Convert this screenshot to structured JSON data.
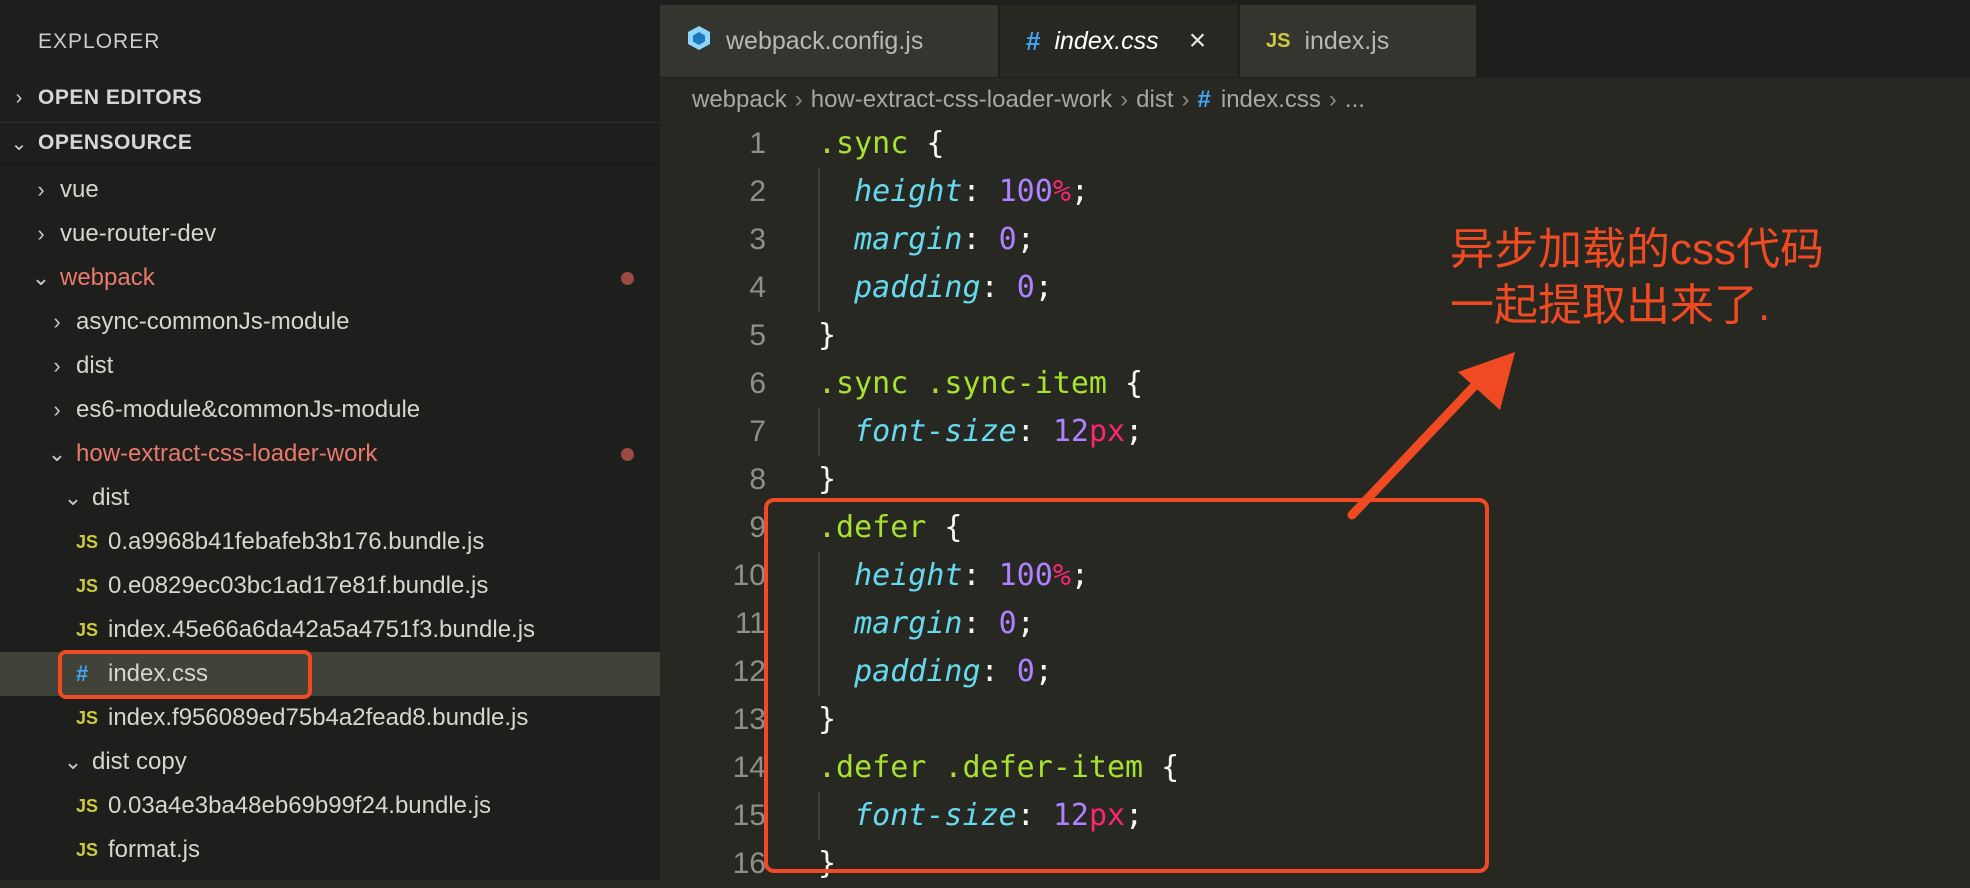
{
  "sidebar": {
    "title": "EXPLORER",
    "sections": [
      {
        "label": "OPEN EDITORS",
        "expanded": false
      },
      {
        "label": "OPENSOURCE",
        "expanded": true
      }
    ],
    "tree": [
      {
        "name": "vue",
        "kind": "folder",
        "expanded": false,
        "depth": 1
      },
      {
        "name": "vue-router-dev",
        "kind": "folder",
        "expanded": false,
        "depth": 1
      },
      {
        "name": "webpack",
        "kind": "folder",
        "expanded": true,
        "depth": 1,
        "modified": true
      },
      {
        "name": "async-commonJs-module",
        "kind": "folder",
        "expanded": false,
        "depth": 2
      },
      {
        "name": "dist",
        "kind": "folder",
        "expanded": false,
        "depth": 2
      },
      {
        "name": "es6-module&commonJs-module",
        "kind": "folder",
        "expanded": false,
        "depth": 2
      },
      {
        "name": "how-extract-css-loader-work",
        "kind": "folder",
        "expanded": true,
        "depth": 2,
        "modified": true
      },
      {
        "name": "dist",
        "kind": "folder",
        "expanded": true,
        "depth": 3
      },
      {
        "name": "0.a9968b41febafeb3b176.bundle.js",
        "kind": "js",
        "depth": 4
      },
      {
        "name": "0.e0829ec03bc1ad17e81f.bundle.js",
        "kind": "js",
        "depth": 4
      },
      {
        "name": "index.45e66a6da42a5a4751f3.bundle.js",
        "kind": "js",
        "depth": 4
      },
      {
        "name": "index.css",
        "kind": "css",
        "depth": 4,
        "selected": true
      },
      {
        "name": "index.f956089ed75b4a2fead8.bundle.js",
        "kind": "js",
        "depth": 4
      },
      {
        "name": "dist copy",
        "kind": "folder",
        "expanded": true,
        "depth": 3
      },
      {
        "name": "0.03a4e3ba48eb69b99f24.bundle.js",
        "kind": "js",
        "depth": 4
      },
      {
        "name": "format.js",
        "kind": "js",
        "depth": 4
      }
    ]
  },
  "tabs": [
    {
      "label": "webpack.config.js",
      "icon": "webpack-icon",
      "active": false
    },
    {
      "label": "index.css",
      "icon": "css-hash-icon",
      "active": true,
      "close": "×"
    },
    {
      "label": "index.js",
      "icon": "js-icon",
      "active": false
    }
  ],
  "breadcrumb": {
    "parts": [
      "webpack",
      "how-extract-css-loader-work",
      "dist"
    ],
    "file": "index.css",
    "tail": "...",
    "separator": "›"
  },
  "code": [
    {
      "n": "1",
      "tokens": [
        [
          "sel",
          ".sync"
        ],
        [
          "punc",
          " {"
        ]
      ]
    },
    {
      "n": "2",
      "indent": true,
      "tokens": [
        [
          "prop",
          "height"
        ],
        [
          "punc",
          ": "
        ],
        [
          "num",
          "100"
        ],
        [
          "unit",
          "%"
        ],
        [
          "punc",
          ";"
        ]
      ]
    },
    {
      "n": "3",
      "indent": true,
      "tokens": [
        [
          "prop",
          "margin"
        ],
        [
          "punc",
          ": "
        ],
        [
          "num",
          "0"
        ],
        [
          "punc",
          ";"
        ]
      ]
    },
    {
      "n": "4",
      "indent": true,
      "tokens": [
        [
          "prop",
          "padding"
        ],
        [
          "punc",
          ": "
        ],
        [
          "num",
          "0"
        ],
        [
          "punc",
          ";"
        ]
      ]
    },
    {
      "n": "5",
      "tokens": [
        [
          "punc",
          "}"
        ]
      ]
    },
    {
      "n": "6",
      "tokens": [
        [
          "sel",
          ".sync .sync-item"
        ],
        [
          "punc",
          " {"
        ]
      ]
    },
    {
      "n": "7",
      "indent": true,
      "tokens": [
        [
          "prop",
          "font-size"
        ],
        [
          "punc",
          ": "
        ],
        [
          "num",
          "12"
        ],
        [
          "unit",
          "px"
        ],
        [
          "punc",
          ";"
        ]
      ]
    },
    {
      "n": "8",
      "tokens": [
        [
          "punc",
          "}"
        ]
      ]
    },
    {
      "n": "9",
      "tokens": [
        [
          "sel",
          ".defer"
        ],
        [
          "punc",
          " {"
        ]
      ]
    },
    {
      "n": "10",
      "indent": true,
      "tokens": [
        [
          "prop",
          "height"
        ],
        [
          "punc",
          ": "
        ],
        [
          "num",
          "100"
        ],
        [
          "unit",
          "%"
        ],
        [
          "punc",
          ";"
        ]
      ]
    },
    {
      "n": "11",
      "indent": true,
      "tokens": [
        [
          "prop",
          "margin"
        ],
        [
          "punc",
          ": "
        ],
        [
          "num",
          "0"
        ],
        [
          "punc",
          ";"
        ]
      ]
    },
    {
      "n": "12",
      "indent": true,
      "tokens": [
        [
          "prop",
          "padding"
        ],
        [
          "punc",
          ": "
        ],
        [
          "num",
          "0"
        ],
        [
          "punc",
          ";"
        ]
      ]
    },
    {
      "n": "13",
      "tokens": [
        [
          "punc",
          "}"
        ]
      ]
    },
    {
      "n": "14",
      "tokens": [
        [
          "sel",
          ".defer .defer-item"
        ],
        [
          "punc",
          " {"
        ]
      ]
    },
    {
      "n": "15",
      "indent": true,
      "tokens": [
        [
          "prop",
          "font-size"
        ],
        [
          "punc",
          ": "
        ],
        [
          "num",
          "12"
        ],
        [
          "unit",
          "px"
        ],
        [
          "punc",
          ";"
        ]
      ]
    },
    {
      "n": "16",
      "tokens": [
        [
          "punc",
          "}"
        ]
      ]
    }
  ],
  "annotation": {
    "text": "异步加载的css代码\n一起提取出来了.",
    "color": "#f04a23"
  },
  "colors": {
    "selector": "#a6e22e",
    "property": "#66d9ef",
    "number": "#ae81ff",
    "unit": "#f92672",
    "modified": "#e9796c",
    "highlight": "#f04a23"
  }
}
